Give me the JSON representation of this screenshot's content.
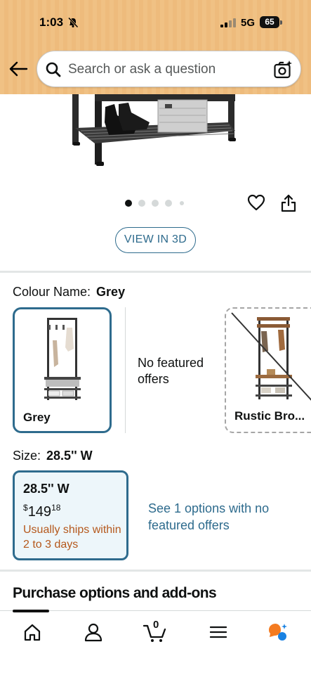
{
  "status_bar": {
    "time": "1:03",
    "network": "5G",
    "battery": "65"
  },
  "search": {
    "placeholder": "Search or ask a question"
  },
  "product": {
    "image_count": 5,
    "active_image_index": 0,
    "view_3d_label": "VIEW IN 3D"
  },
  "colour": {
    "label": "Colour Name:",
    "selected": "Grey",
    "options": [
      {
        "name": "Grey",
        "selected": true,
        "available": true
      },
      {
        "name": "Rustic Bro...",
        "selected": false,
        "available": false
      }
    ],
    "no_featured_offers": "No featured offers"
  },
  "size": {
    "label": "Size:",
    "selected": "28.5'' W",
    "card": {
      "title": "28.5'' W",
      "price_symbol": "$",
      "price_whole": "149",
      "price_fraction": "18",
      "shipping": "Usually ships within 2 to 3 days"
    },
    "see_options": "See 1 options with no featured offers"
  },
  "purchase_options": {
    "heading": "Purchase options and add-ons"
  },
  "bottom_nav": {
    "items": [
      "home-icon",
      "account-icon",
      "cart-icon",
      "menu-icon",
      "rufus-icon"
    ],
    "cart_count": "0"
  },
  "colors": {
    "header_bg": "#f0c184",
    "accent_blue": "#2e6b8d",
    "ships_orange": "#b5581c",
    "selected_card_bg": "#edf6fa",
    "rufus_orange": "#f47b20",
    "rufus_blue": "#1a82e2"
  }
}
